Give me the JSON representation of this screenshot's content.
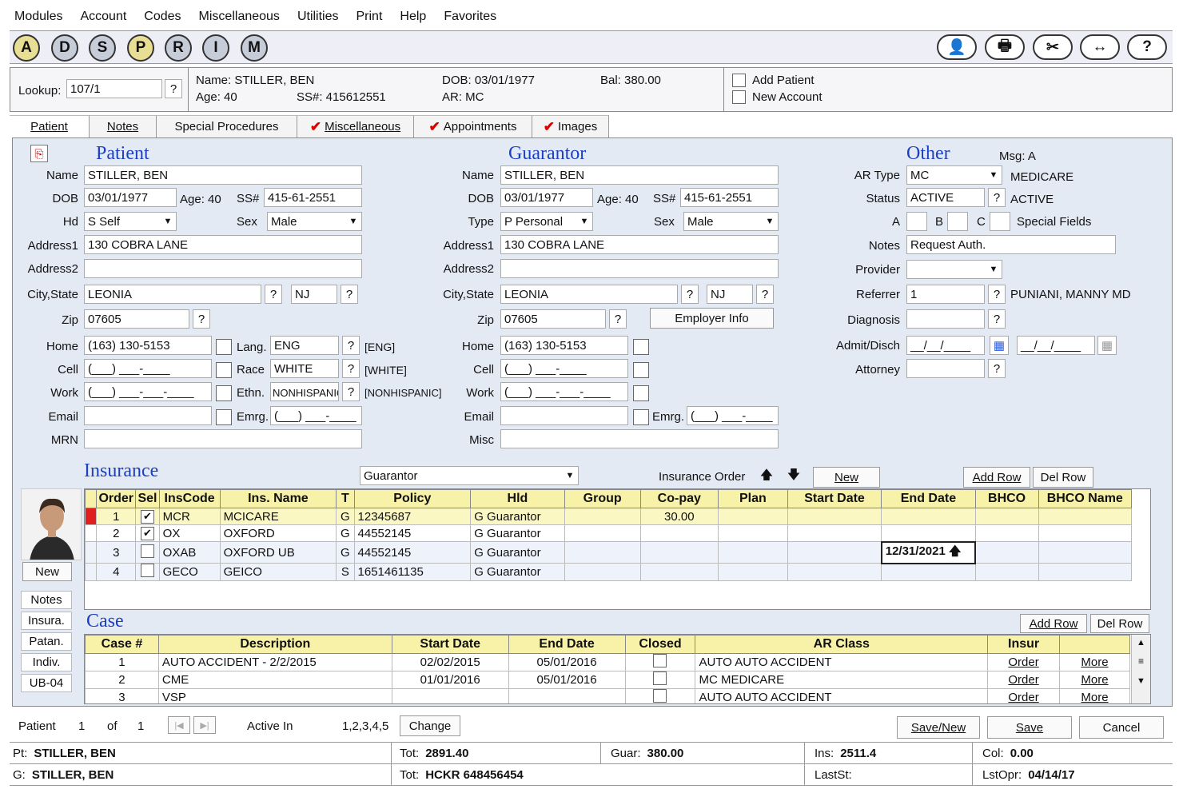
{
  "menu": [
    "Modules",
    "Account",
    "Codes",
    "Miscellaneous",
    "Utilities",
    "Print",
    "Help",
    "Favorites"
  ],
  "toolbar": {
    "circles": [
      "A",
      "D",
      "S",
      "P",
      "R",
      "I",
      "M"
    ],
    "right_icons": [
      "user-stamp-icon",
      "printer-icon",
      "tools-icon",
      "swap-arrows-icon",
      "help-icon"
    ],
    "right_glyphs": [
      "👤",
      "🖶",
      "✂",
      "↔",
      "?"
    ]
  },
  "header": {
    "lookup_label": "Lookup:",
    "lookup_value": "107/1",
    "q": "?",
    "name": "Name:  STILLER, BEN",
    "age": "Age:  40",
    "ssn": "SS#:  415612551",
    "dob": "DOB:  03/01/1977",
    "ar": "AR:  MC",
    "bal": "Bal:  380.00",
    "add_patient": "Add Patient",
    "new_account": "New Account"
  },
  "tabs": [
    "Patient",
    "Notes",
    "Special Procedures",
    "Miscellaneous",
    "Appointments",
    "Images"
  ],
  "patient": {
    "title": "Patient",
    "name_l": "Name",
    "name": "STILLER, BEN",
    "dob_l": "DOB",
    "dob": "03/01/1977",
    "age_l": "Age:",
    "age": "40",
    "ss_l": "SS#",
    "ss": "415-61-2551",
    "hd_l": "Hd",
    "hd": "S  Self",
    "sex_l": "Sex",
    "sex": "Male",
    "addr1_l": "Address1",
    "addr1": "130 COBRA LANE",
    "addr2_l": "Address2",
    "addr2": "",
    "city_l": "City,State",
    "city": "LEONIA",
    "state": "NJ",
    "zip_l": "Zip",
    "zip": "07605",
    "home_l": "Home",
    "home": "(163) 130-5153",
    "lang_l": "Lang.",
    "lang": "ENG",
    "lang_code": "[ENG]",
    "cell_l": "Cell",
    "cell": "(___) ___-____",
    "race_l": "Race",
    "race": "WHITE",
    "race_code": "[WHITE]",
    "work_l": "Work",
    "work": "(___) ___-___-____",
    "ethn_l": "Ethn.",
    "ethn": "NONHISPANIC",
    "ethn_code": "[NONHISPANIC]",
    "email_l": "Email",
    "email": "",
    "emrg_l": "Emrg.",
    "emrg": "(___) ___-____",
    "mrn_l": "MRN",
    "mrn": ""
  },
  "guarantor": {
    "title": "Guarantor",
    "name_l": "Name",
    "name": "STILLER, BEN",
    "dob_l": "DOB",
    "dob": "03/01/1977",
    "age_l": "Age:",
    "age": "40",
    "ss_l": "SS#",
    "ss": "415-61-2551",
    "type_l": "Type",
    "type": "P  Personal",
    "sex_l": "Sex",
    "sex": "Male",
    "addr1_l": "Address1",
    "addr1": "130 COBRA LANE",
    "addr2_l": "Address2",
    "addr2": "",
    "city_l": "City,State",
    "city": "LEONIA",
    "state": "NJ",
    "zip_l": "Zip",
    "zip": "07605",
    "employer": "Employer Info",
    "home_l": "Home",
    "home": "(163) 130-5153",
    "cell_l": "Cell",
    "cell": "(___) ___-____",
    "work_l": "Work",
    "work": "(___) ___-___-____",
    "email_l": "Email",
    "email": "",
    "emrg_l": "Emrg.",
    "emrg": "(___) ___-____",
    "misc_l": "Misc",
    "misc": ""
  },
  "other": {
    "title": "Other",
    "msg": "Msg: A",
    "artype_l": "AR Type",
    "artype": "MC",
    "artype_desc": "MEDICARE",
    "status_l": "Status",
    "status": "ACTIVE",
    "status_desc": "ACTIVE",
    "a_l": "A",
    "b_l": "B",
    "c_l": "C",
    "special": "Special Fields",
    "notes_l": "Notes",
    "notes": "Request Auth.",
    "provider_l": "Provider",
    "provider": "",
    "referrer_l": "Referrer",
    "referrer": "1",
    "referrer_desc": "PUNIANI, MANNY MD",
    "diagnosis_l": "Diagnosis",
    "admit_l": "Admit/Disch",
    "admit": "__/__/____",
    "disch": "__/__/____",
    "attorney_l": "Attorney"
  },
  "insurance": {
    "title": "Insurance",
    "filter": "Guarantor",
    "order_label": "Insurance Order",
    "up": "🡅",
    "down": "🡇",
    "new": "New",
    "add_row": "Add Row",
    "del_row": "Del Row",
    "photo_new": "New",
    "columns": [
      "Order",
      "Sel",
      "InsCode",
      "Ins. Name",
      "T",
      "Policy",
      "Hld",
      "Group",
      "Co-pay",
      "Plan",
      "Start Date",
      "End Date",
      "BHCO",
      "BHCO Name"
    ],
    "rows": [
      {
        "order": "1",
        "sel": "✔",
        "code": "MCR",
        "name": "MCICARE",
        "t": "G",
        "policy": "12345687",
        "hld": "G  Guarantor",
        "group": "",
        "copay": "30.00",
        "plan": "",
        "start": "",
        "end": "",
        "bhco": "",
        "bhconame": ""
      },
      {
        "order": "2",
        "sel": "✔",
        "code": "OX",
        "name": "OXFORD",
        "t": "G",
        "policy": "44552145",
        "hld": "G  Guarantor",
        "group": "",
        "copay": "",
        "plan": "",
        "start": "",
        "end": "",
        "bhco": "",
        "bhconame": ""
      },
      {
        "order": "3",
        "sel": "",
        "code": "OXAB",
        "name": "OXFORD UB",
        "t": "G",
        "policy": "44552145",
        "hld": "G  Guarantor",
        "group": "",
        "copay": "",
        "plan": "",
        "start": "",
        "end": "12/31/2021",
        "bhco": "",
        "bhconame": ""
      },
      {
        "order": "4",
        "sel": "",
        "code": "GECO",
        "name": "GEICO",
        "t": "S",
        "policy": "1651461135",
        "hld": "G  Guarantor",
        "group": "",
        "copay": "",
        "plan": "",
        "start": "",
        "end": "",
        "bhco": "",
        "bhconame": ""
      }
    ]
  },
  "side_buttons": [
    "Notes",
    "Insura.",
    "Patan.",
    "Indiv.",
    "UB-04"
  ],
  "case": {
    "title": "Case",
    "add_row": "Add Row",
    "del_row": "Del Row",
    "columns": [
      "Case #",
      "Description",
      "Start Date",
      "End Date",
      "Closed",
      "AR Class",
      "Insur",
      ""
    ],
    "rows": [
      {
        "num": "1",
        "desc": "AUTO ACCIDENT - 2/2/2015",
        "start": "02/02/2015",
        "end": "05/01/2016",
        "arclass": "AUTO  AUTO ACCIDENT",
        "order": "Order",
        "more": "More"
      },
      {
        "num": "2",
        "desc": "CME",
        "start": "01/01/2016",
        "end": "05/01/2016",
        "arclass": "MC  MEDICARE",
        "order": "Order",
        "more": "More"
      },
      {
        "num": "3",
        "desc": "VSP",
        "start": "",
        "end": "",
        "arclass": "AUTO  AUTO ACCIDENT",
        "order": "Order",
        "more": "More"
      }
    ]
  },
  "footer": {
    "patient_l": "Patient",
    "cur": "1",
    "of": "of",
    "total": "1",
    "active_in_l": "Active In",
    "active_in": "1,2,3,4,5",
    "change": "Change",
    "save_new": "Save/New",
    "save": "Save",
    "cancel": "Cancel"
  },
  "status": {
    "pt_l": "Pt:",
    "pt": "STILLER, BEN",
    "tot_l": "Tot:",
    "tot": "2891.40",
    "guar_l": "Guar:",
    "guar": "380.00",
    "ins_l": "Ins:",
    "ins": "2511.4",
    "col_l": "Col:",
    "col": "0.00",
    "g_l": "G:",
    "g": "STILLER, BEN",
    "tot2_l": "Tot:",
    "tot2": "HCKR  648456454",
    "laststmt_l": "LastSt:",
    "laststmt": "",
    "lstopr_l": "LstOpr:",
    "lstopr": "04/14/17"
  }
}
